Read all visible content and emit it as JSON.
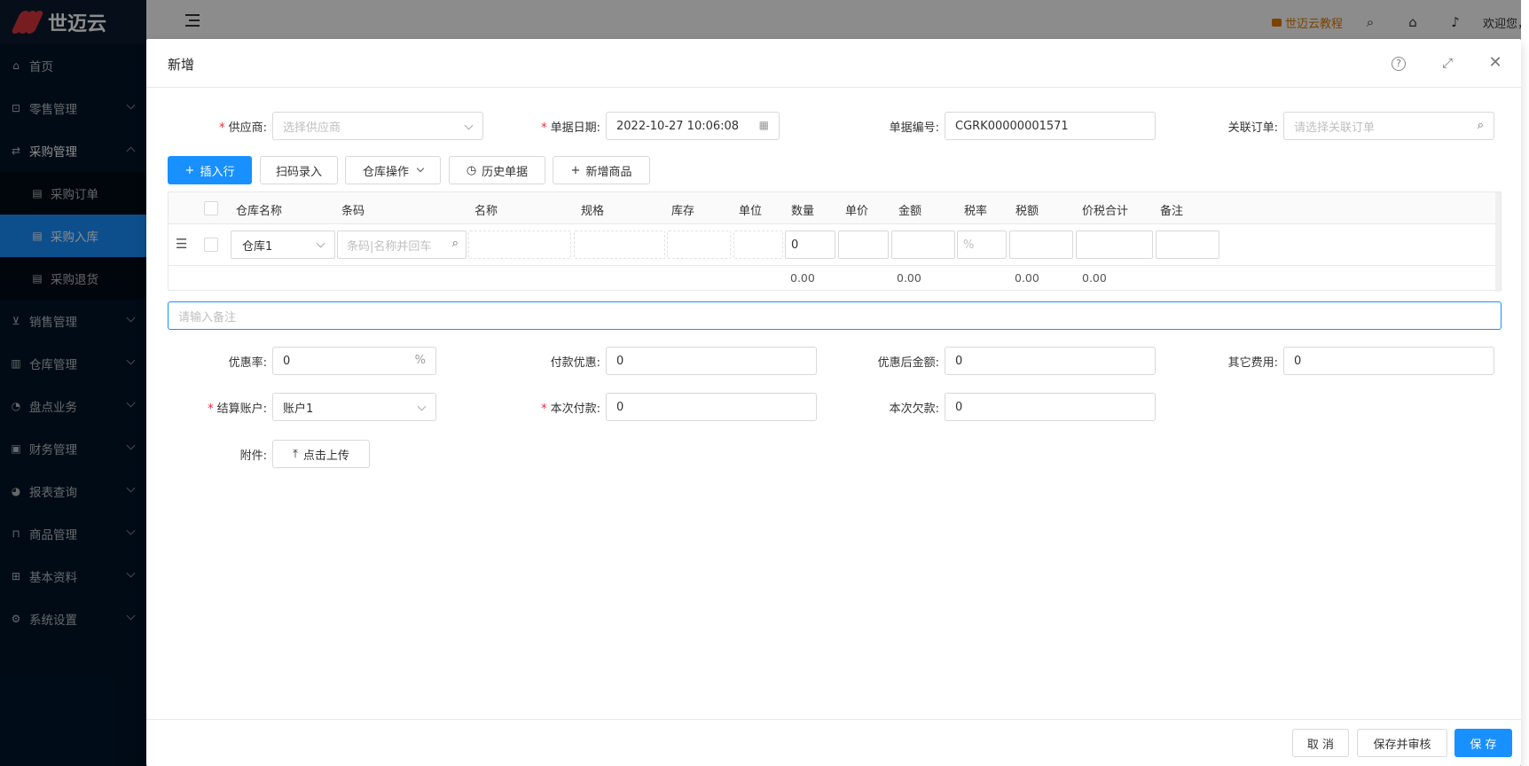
{
  "app": {
    "logo_text": "世迈云"
  },
  "sidebar": {
    "items": [
      {
        "label": "首页",
        "icon": "home-icon"
      },
      {
        "label": "零售管理",
        "icon": "gift-icon"
      },
      {
        "label": "采购管理",
        "icon": "swap-icon"
      },
      {
        "label": "销售管理",
        "icon": "cart-icon"
      },
      {
        "label": "仓库管理",
        "icon": "storage-icon"
      },
      {
        "label": "盘点业务",
        "icon": "dashboard-icon"
      },
      {
        "label": "财务管理",
        "icon": "finance-icon"
      },
      {
        "label": "报表查询",
        "icon": "pie-icon"
      },
      {
        "label": "商品管理",
        "icon": "goods-icon"
      },
      {
        "label": "基本资料",
        "icon": "grid-icon"
      },
      {
        "label": "系统设置",
        "icon": "setting-icon"
      }
    ],
    "purchase_sub": [
      {
        "label": "采购订单"
      },
      {
        "label": "采购入库"
      },
      {
        "label": "采购退货"
      }
    ]
  },
  "header": {
    "tutorial": "世迈云教程",
    "welcome": "欢迎您，"
  },
  "modal": {
    "title": "新增",
    "form": {
      "supplier_label": "供应商:",
      "supplier_placeholder": "选择供应商",
      "date_label": "单据日期:",
      "date_value": "2022-10-27 10:06:08",
      "number_label": "单据编号:",
      "number_value": "CGRK00000001571",
      "order_label": "关联订单:",
      "order_placeholder": "请选择关联订单"
    },
    "toolbar": {
      "insert_row": "插入行",
      "scan": "扫码录入",
      "warehouse_ops": "仓库操作",
      "history": "历史单据",
      "new_goods": "新增商品"
    },
    "table": {
      "columns": [
        "仓库名称",
        "条码",
        "名称",
        "规格",
        "库存",
        "单位",
        "数量",
        "单价",
        "金额",
        "税率",
        "税额",
        "价税合计",
        "备注"
      ],
      "row": {
        "warehouse": "仓库1",
        "barcode_placeholder": "条码|名称并回车",
        "quantity": "0",
        "tax_rate_suffix": "%"
      },
      "totals": {
        "quantity": "0.00",
        "amount": "0.00",
        "tax": "0.00",
        "total": "0.00"
      }
    },
    "remark_placeholder": "请输入备注",
    "payment": {
      "discount_rate_label": "优惠率:",
      "discount_rate_value": "0",
      "discount_rate_suffix": "%",
      "pay_discount_label": "付款优惠:",
      "pay_discount_value": "0",
      "after_discount_label": "优惠后金额:",
      "after_discount_value": "0",
      "other_fee_label": "其它费用:",
      "other_fee_value": "0",
      "account_label": "结算账户:",
      "account_value": "账户1",
      "this_pay_label": "本次付款:",
      "this_pay_value": "0",
      "debt_label": "本次欠款:",
      "debt_value": "0",
      "attachment_label": "附件:",
      "upload_label": "点击上传"
    },
    "footer": {
      "cancel": "取 消",
      "save_audit": "保存并审核",
      "save": "保 存"
    }
  }
}
